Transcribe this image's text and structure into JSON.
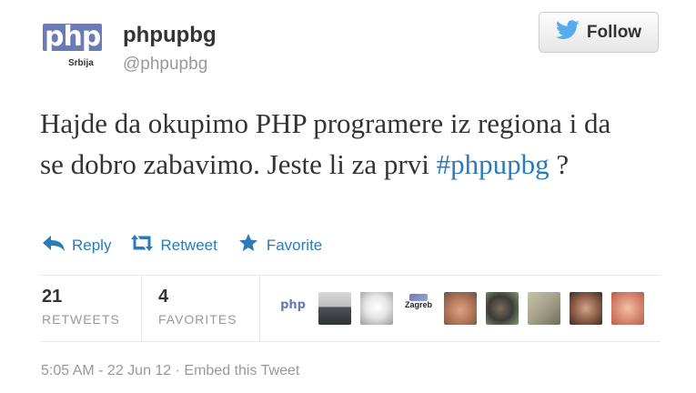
{
  "header": {
    "logo_text": "php",
    "logo_subtext": "Srbija",
    "display_name": "phpupbg",
    "screen_name": "@phpupbg",
    "follow_label": "Follow"
  },
  "tweet": {
    "text_before": "Hajde da okupimo PHP programere iz regiona i da se dobro zabavimo. Jeste li za prvi ",
    "hashtag": "#phpupbg",
    "text_after": " ?"
  },
  "actions": {
    "reply_label": "Reply",
    "retweet_label": "Retweet",
    "favorite_label": "Favorite"
  },
  "stats": {
    "retweets_count": "21",
    "retweets_label": "RETWEETS",
    "favorites_count": "4",
    "favorites_label": "FAVORITES"
  },
  "faces": [
    {
      "name": "php",
      "text": "php"
    },
    {
      "name": "person-1"
    },
    {
      "name": "person-2"
    },
    {
      "name": "zagreb",
      "text": "Zagreb"
    },
    {
      "name": "person-3"
    },
    {
      "name": "person-4"
    },
    {
      "name": "person-5"
    },
    {
      "name": "person-6"
    },
    {
      "name": "person-7"
    }
  ],
  "footer": {
    "time": "5:05 AM - 22 Jun 12",
    "separator": " · ",
    "embed_label": "Embed this Tweet"
  },
  "colors": {
    "link": "#2b7bb9",
    "muted": "#999999",
    "text": "#333333",
    "twitter_bird": "#55acee"
  }
}
